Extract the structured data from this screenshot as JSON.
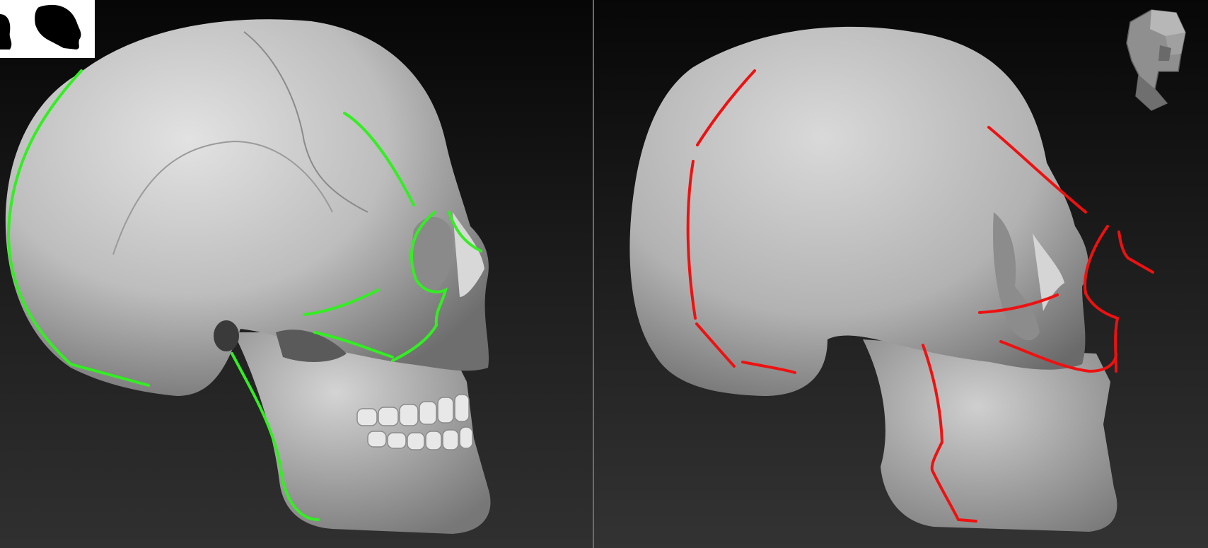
{
  "viewports": [
    {
      "name": "reference-skull-view",
      "guide_color": "#33ee22",
      "view": "side"
    },
    {
      "name": "sculpt-skull-view",
      "guide_color": "#ee1111",
      "view": "side"
    }
  ],
  "colors": {
    "background_top": "#060606",
    "background_bottom": "#303030",
    "divider": "#6c6c6c",
    "bone": "#c8c8c8",
    "thumbnail_bg": "#ffffff"
  },
  "icons": {
    "silhouette_thumbnail": "head-silhouette-icon",
    "navigation_cube": "head-navigation-icon"
  }
}
